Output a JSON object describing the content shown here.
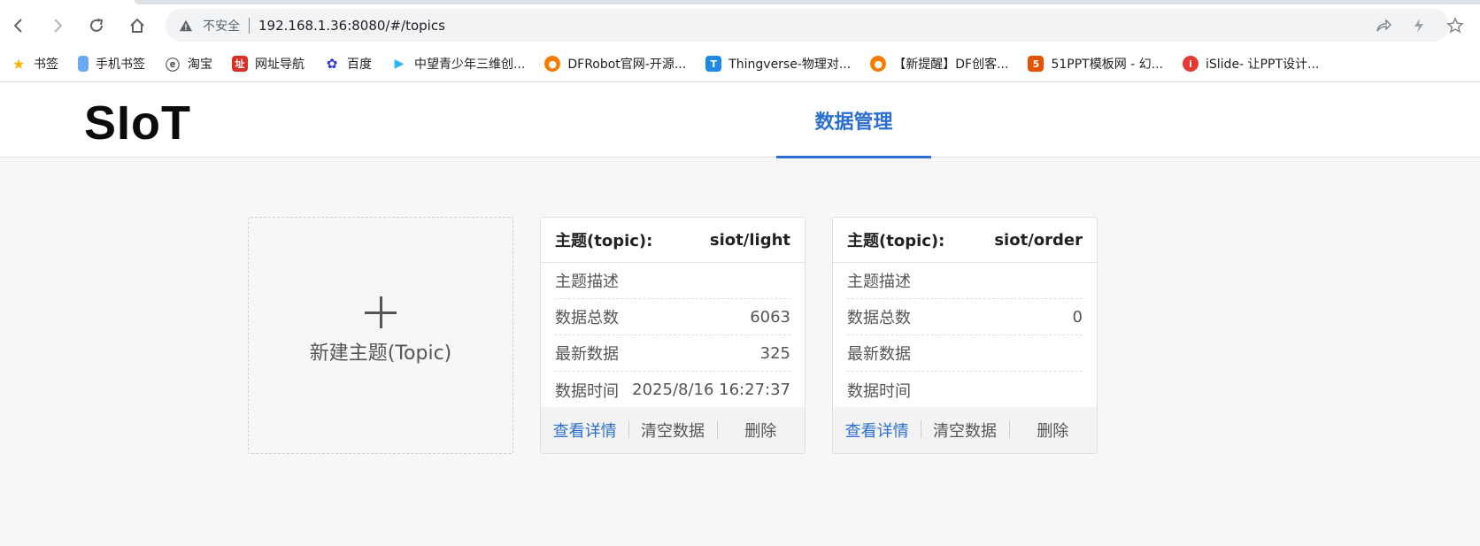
{
  "browser": {
    "insecure_label": "不安全",
    "url": "192.168.1.36:8080/#/topics",
    "bookmarks": [
      {
        "label": "书签",
        "icon": "star-icon",
        "color": "#f4b400"
      },
      {
        "label": "手机书签",
        "icon": "phone-icon",
        "color": "#4285f4"
      },
      {
        "label": "淘宝",
        "icon": "taobao-icon",
        "color": "#555555"
      },
      {
        "label": "网址导航",
        "icon": "navigation-icon",
        "color": "#d93025"
      },
      {
        "label": "百度",
        "icon": "baidu-paw-icon",
        "color": "#2932e1"
      },
      {
        "label": "中望青少年三维创...",
        "icon": "play-icon",
        "color": "#29b6f6"
      },
      {
        "label": "DFRobot官网-开源...",
        "icon": "dfrobot-icon",
        "color": "#f57c00"
      },
      {
        "label": "Thingverse-物理对...",
        "icon": "thingverse-icon",
        "color": "#1e88e5"
      },
      {
        "label": "【新提醒】DF创客...",
        "icon": "dfrobot-icon",
        "color": "#f57c00"
      },
      {
        "label": "51PPT模板网 - 幻...",
        "icon": "51ppt-icon",
        "color": "#e65100"
      },
      {
        "label": "iSlide- 让PPT设计...",
        "icon": "islide-icon",
        "color": "#e53935"
      }
    ]
  },
  "app": {
    "logo": "SIoT",
    "nav_tab": "数据管理"
  },
  "new_topic": {
    "label": "新建主题(Topic)"
  },
  "topics": [
    {
      "head_label": "主题(topic):",
      "name": "siot/light",
      "rows": [
        {
          "label": "主题描述",
          "value": ""
        },
        {
          "label": "数据总数",
          "value": "6063"
        },
        {
          "label": "最新数据",
          "value": "325"
        },
        {
          "label": "数据时间",
          "value": "2025/8/16 16:27:37"
        }
      ],
      "actions": [
        "查看详情",
        "清空数据",
        "删除"
      ]
    },
    {
      "head_label": "主题(topic):",
      "name": "siot/order",
      "rows": [
        {
          "label": "主题描述",
          "value": ""
        },
        {
          "label": "数据总数",
          "value": "0"
        },
        {
          "label": "最新数据",
          "value": ""
        },
        {
          "label": "数据时间",
          "value": ""
        }
      ],
      "actions": [
        "查看详情",
        "清空数据",
        "删除"
      ]
    }
  ],
  "colors": {
    "accent": "#2a6fd1"
  }
}
